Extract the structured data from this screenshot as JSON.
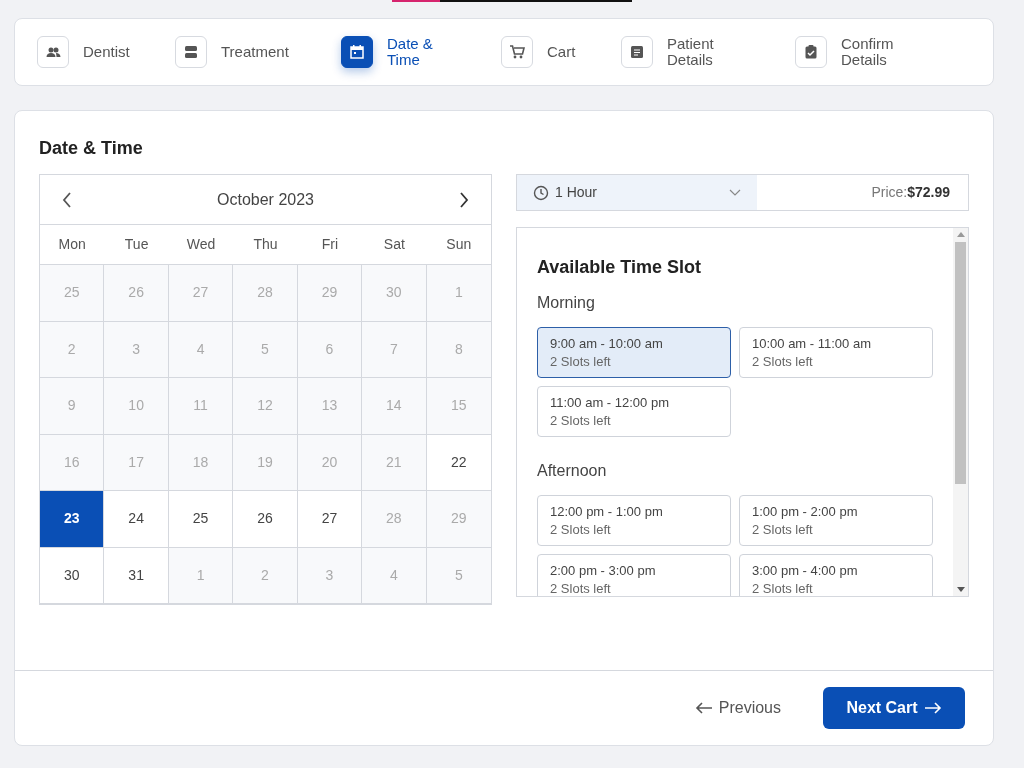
{
  "steps": [
    {
      "label": "Dentist",
      "selected": false
    },
    {
      "label": "Treatment",
      "selected": false
    },
    {
      "label": "Date & Time",
      "selected": true
    },
    {
      "label": "Cart",
      "selected": false
    },
    {
      "label": "Patient Details",
      "selected": false
    },
    {
      "label": "Confirm Details",
      "selected": false
    }
  ],
  "section_title": "Date & Time",
  "calendar": {
    "month": "October 2023",
    "weekdays": [
      "Mon",
      "Tue",
      "Wed",
      "Thu",
      "Fri",
      "Sat",
      "Sun"
    ],
    "days": [
      {
        "label": "25",
        "available": false,
        "selected": false
      },
      {
        "label": "26",
        "available": false,
        "selected": false
      },
      {
        "label": "27",
        "available": false,
        "selected": false
      },
      {
        "label": "28",
        "available": false,
        "selected": false
      },
      {
        "label": "29",
        "available": false,
        "selected": false
      },
      {
        "label": "30",
        "available": false,
        "selected": false
      },
      {
        "label": "1",
        "available": false,
        "selected": false
      },
      {
        "label": "2",
        "available": false,
        "selected": false
      },
      {
        "label": "3",
        "available": false,
        "selected": false
      },
      {
        "label": "4",
        "available": false,
        "selected": false
      },
      {
        "label": "5",
        "available": false,
        "selected": false
      },
      {
        "label": "6",
        "available": false,
        "selected": false
      },
      {
        "label": "7",
        "available": false,
        "selected": false
      },
      {
        "label": "8",
        "available": false,
        "selected": false
      },
      {
        "label": "9",
        "available": false,
        "selected": false
      },
      {
        "label": "10",
        "available": false,
        "selected": false
      },
      {
        "label": "11",
        "available": false,
        "selected": false
      },
      {
        "label": "12",
        "available": false,
        "selected": false
      },
      {
        "label": "13",
        "available": false,
        "selected": false
      },
      {
        "label": "14",
        "available": false,
        "selected": false
      },
      {
        "label": "15",
        "available": false,
        "selected": false
      },
      {
        "label": "16",
        "available": false,
        "selected": false
      },
      {
        "label": "17",
        "available": false,
        "selected": false
      },
      {
        "label": "18",
        "available": false,
        "selected": false
      },
      {
        "label": "19",
        "available": false,
        "selected": false
      },
      {
        "label": "20",
        "available": false,
        "selected": false
      },
      {
        "label": "21",
        "available": false,
        "selected": false
      },
      {
        "label": "22",
        "available": true,
        "selected": false
      },
      {
        "label": "23",
        "available": true,
        "selected": true
      },
      {
        "label": "24",
        "available": true,
        "selected": false
      },
      {
        "label": "25",
        "available": true,
        "selected": false
      },
      {
        "label": "26",
        "available": true,
        "selected": false
      },
      {
        "label": "27",
        "available": true,
        "selected": false
      },
      {
        "label": "28",
        "available": false,
        "selected": false
      },
      {
        "label": "29",
        "available": false,
        "selected": false
      },
      {
        "label": "30",
        "available": true,
        "selected": false
      },
      {
        "label": "31",
        "available": true,
        "selected": false
      },
      {
        "label": "1",
        "available": false,
        "selected": false
      },
      {
        "label": "2",
        "available": false,
        "selected": false
      },
      {
        "label": "3",
        "available": false,
        "selected": false
      },
      {
        "label": "4",
        "available": false,
        "selected": false
      },
      {
        "label": "5",
        "available": false,
        "selected": false
      }
    ]
  },
  "duration": {
    "value": "1 Hour"
  },
  "price": {
    "label": "Price:",
    "value": "$72.99"
  },
  "slots_title": "Available Time Slot",
  "slot_groups": [
    {
      "name": "Morning",
      "slots": [
        {
          "time": "9:00 am - 10:00 am",
          "remaining": "2 Slots left",
          "selected": true
        },
        {
          "time": "10:00 am - 11:00 am",
          "remaining": "2 Slots left",
          "selected": false
        },
        {
          "time": "11:00 am - 12:00 pm",
          "remaining": "2 Slots left",
          "selected": false
        }
      ]
    },
    {
      "name": "Afternoon",
      "slots": [
        {
          "time": "12:00 pm - 1:00 pm",
          "remaining": "2 Slots left",
          "selected": false
        },
        {
          "time": "1:00 pm - 2:00 pm",
          "remaining": "2 Slots left",
          "selected": false
        },
        {
          "time": "2:00 pm - 3:00 pm",
          "remaining": "2 Slots left",
          "selected": false
        },
        {
          "time": "3:00 pm - 4:00 pm",
          "remaining": "2 Slots left",
          "selected": false
        }
      ]
    }
  ],
  "buttons": {
    "previous": "Previous",
    "next": "Next Cart"
  }
}
